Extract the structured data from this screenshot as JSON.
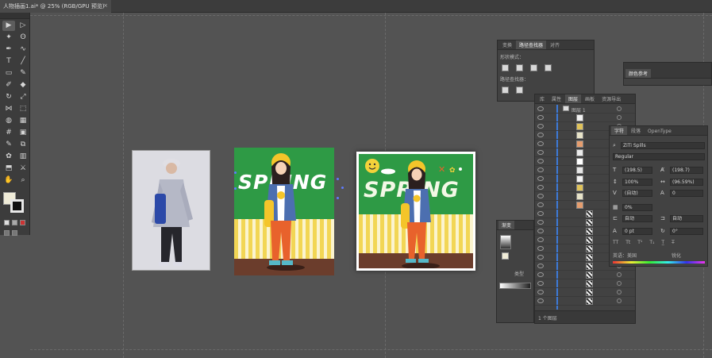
{
  "window": {
    "doc_tab_title": "人物插画1.ai* @ 25% (RGB/GPU 预览)",
    "close_glyph": "×"
  },
  "toolbar": {
    "tool_icons": [
      "selection-tool-icon",
      "direct-selection-tool-icon",
      "magic-wand-icon",
      "lasso-icon",
      "pen-tool-icon",
      "curvature-tool-icon",
      "type-tool-icon",
      "line-tool-icon",
      "rectangle-tool-icon",
      "paintbrush-icon",
      "shaper-tool-icon",
      "eraser-icon",
      "rotate-tool-icon",
      "scale-tool-icon",
      "width-tool-icon",
      "free-transform-icon",
      "shape-builder-icon",
      "perspective-grid-icon",
      "mesh-tool-icon",
      "gradient-tool-icon",
      "eyedropper-icon",
      "blend-tool-icon",
      "symbol-sprayer-icon",
      "column-graph-icon",
      "artboard-tool-icon",
      "slice-tool-icon",
      "hand-tool-icon",
      "zoom-tool-icon"
    ],
    "tool_glyphs": [
      "▶",
      "▷",
      "✦",
      "ʘ",
      "✒",
      "∿",
      "T",
      "╱",
      "▭",
      "✎",
      "✐",
      "◆",
      "↻",
      "⤢",
      "⋈",
      "⬚",
      "◍",
      "▦",
      "#",
      "▣",
      "✎",
      "⧉",
      "✿",
      "▥",
      "⬒",
      "⚔",
      "✋",
      "⌕"
    ]
  },
  "artwork": {
    "spring_text": "SPRING",
    "colors": {
      "sky": "#2e9a45",
      "fence_yellow": "#f2d655",
      "ground": "#6b3d2c",
      "jacket": "#4c6fb0",
      "pants": "#e8622c"
    }
  },
  "panels": {
    "transform": {
      "tabs": [
        "变换",
        "路径查找器",
        "对齐"
      ],
      "shape_modes_label": "形状模式：",
      "pathfinder_label": "路径查找器："
    },
    "color_guide": {
      "tabs": [
        "颜色参考"
      ]
    },
    "layers": {
      "tabs": [
        "库",
        "属性",
        "图层",
        "画板",
        "资源导出"
      ],
      "top_layer_name": "图层 1",
      "footer_label": "1 个图层"
    },
    "gradient": {
      "tabs": [
        "渐变"
      ],
      "type_label": "类型"
    },
    "character": {
      "tabs": [
        "字符",
        "段落",
        "OpenType"
      ],
      "font_family": "ZiTi Spills",
      "font_style": "Regular",
      "font_size": "(198.5)",
      "leading": "(198.7)",
      "vscale": "100%",
      "hscale": "(96.59%)",
      "kerning": "(自动)",
      "tracking": "0",
      "tsume": "0%",
      "aki_left": "自动",
      "aki_right": "自动",
      "baseline": "0 pt",
      "rotation": "0°",
      "tt_label": "TT",
      "t1_label": "Tt",
      "language": "英语：美国",
      "aa": "锐化"
    }
  }
}
